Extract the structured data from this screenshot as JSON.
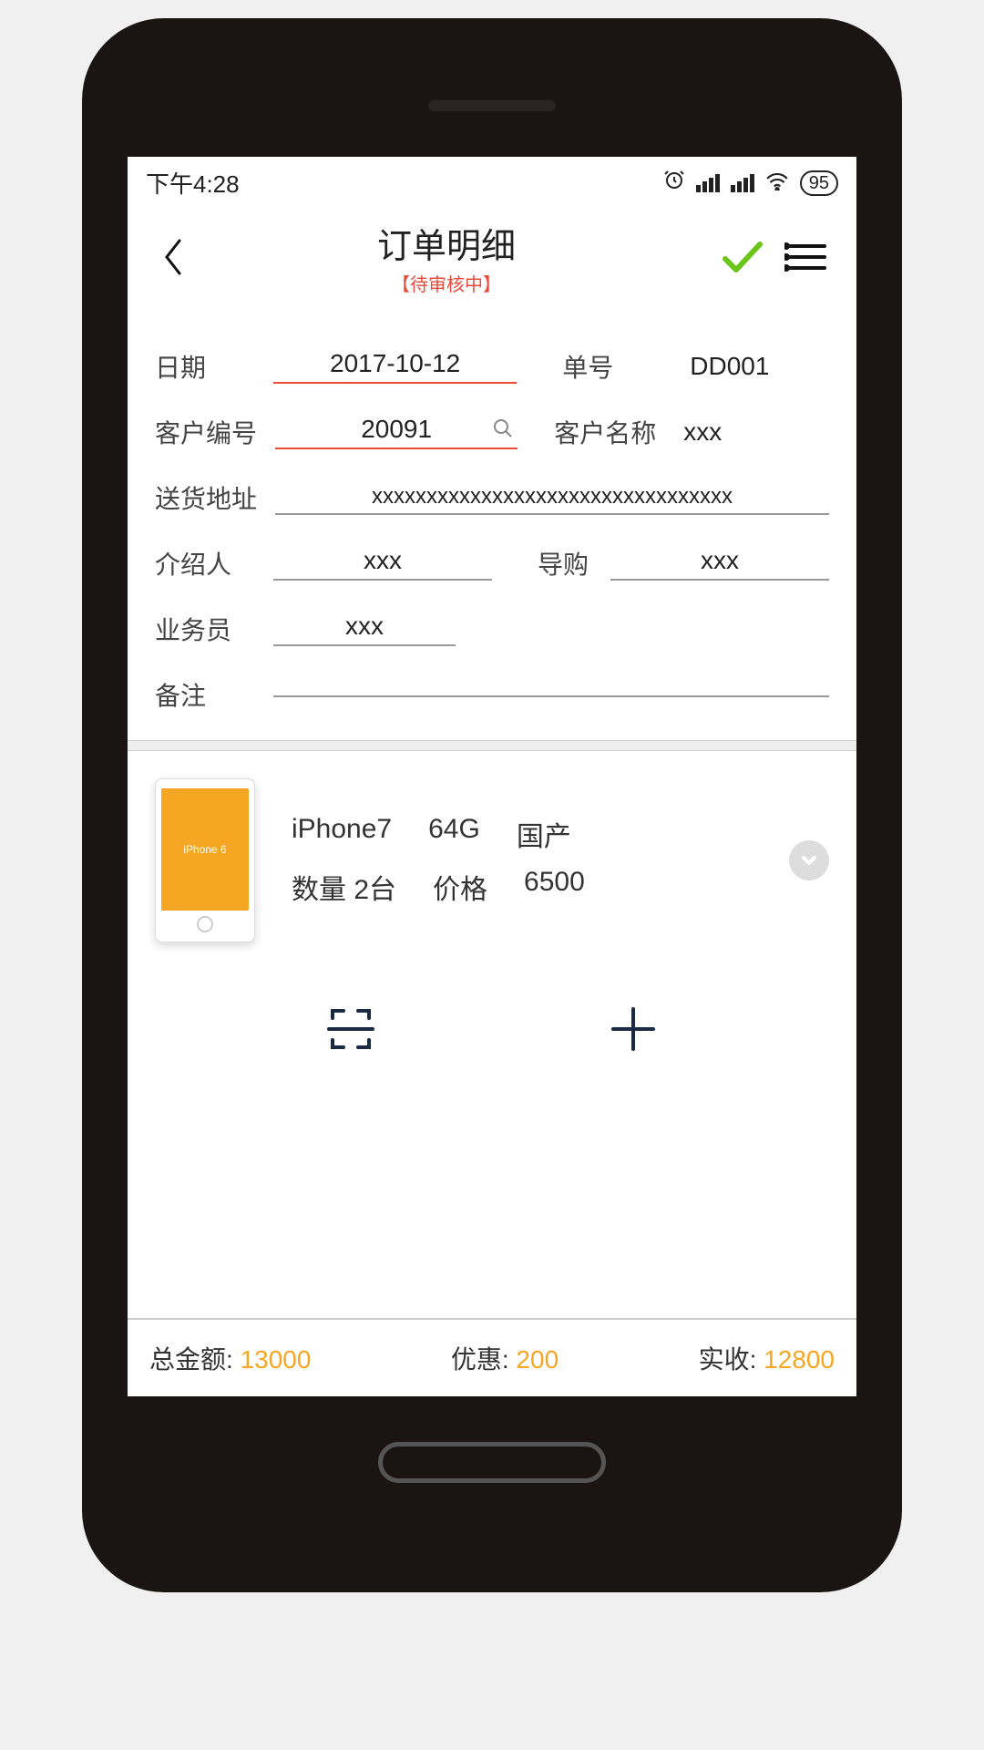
{
  "status_bar": {
    "time": "下午4:28",
    "battery": "95"
  },
  "header": {
    "title": "订单明细",
    "subtitle": "【待审核中】"
  },
  "form": {
    "date_label": "日期",
    "date_value": "2017-10-12",
    "order_no_label": "单号",
    "order_no_value": "DD001",
    "customer_id_label": "客户编号",
    "customer_id_value": "20091",
    "customer_name_label": "客户名称",
    "customer_name_value": "xxx",
    "address_label": "送货地址",
    "address_value": "xxxxxxxxxxxxxxxxxxxxxxxxxxxxxxxxx",
    "referrer_label": "介绍人",
    "referrer_value": "xxx",
    "guide_label": "导购",
    "guide_value": "xxx",
    "sales_label": "业务员",
    "sales_value": "xxx",
    "notes_label": "备注",
    "notes_value": ""
  },
  "product": {
    "thumb_label": "iPhone 6",
    "name": "iPhone7",
    "storage": "64G",
    "origin": "国产",
    "qty_label": "数量",
    "qty_value": "2台",
    "price_label": "价格",
    "price_value": "6500"
  },
  "footer": {
    "total_label": "总金额:",
    "total_value": "13000",
    "discount_label": "优惠:",
    "discount_value": "200",
    "received_label": "实收:",
    "received_value": "12800"
  }
}
